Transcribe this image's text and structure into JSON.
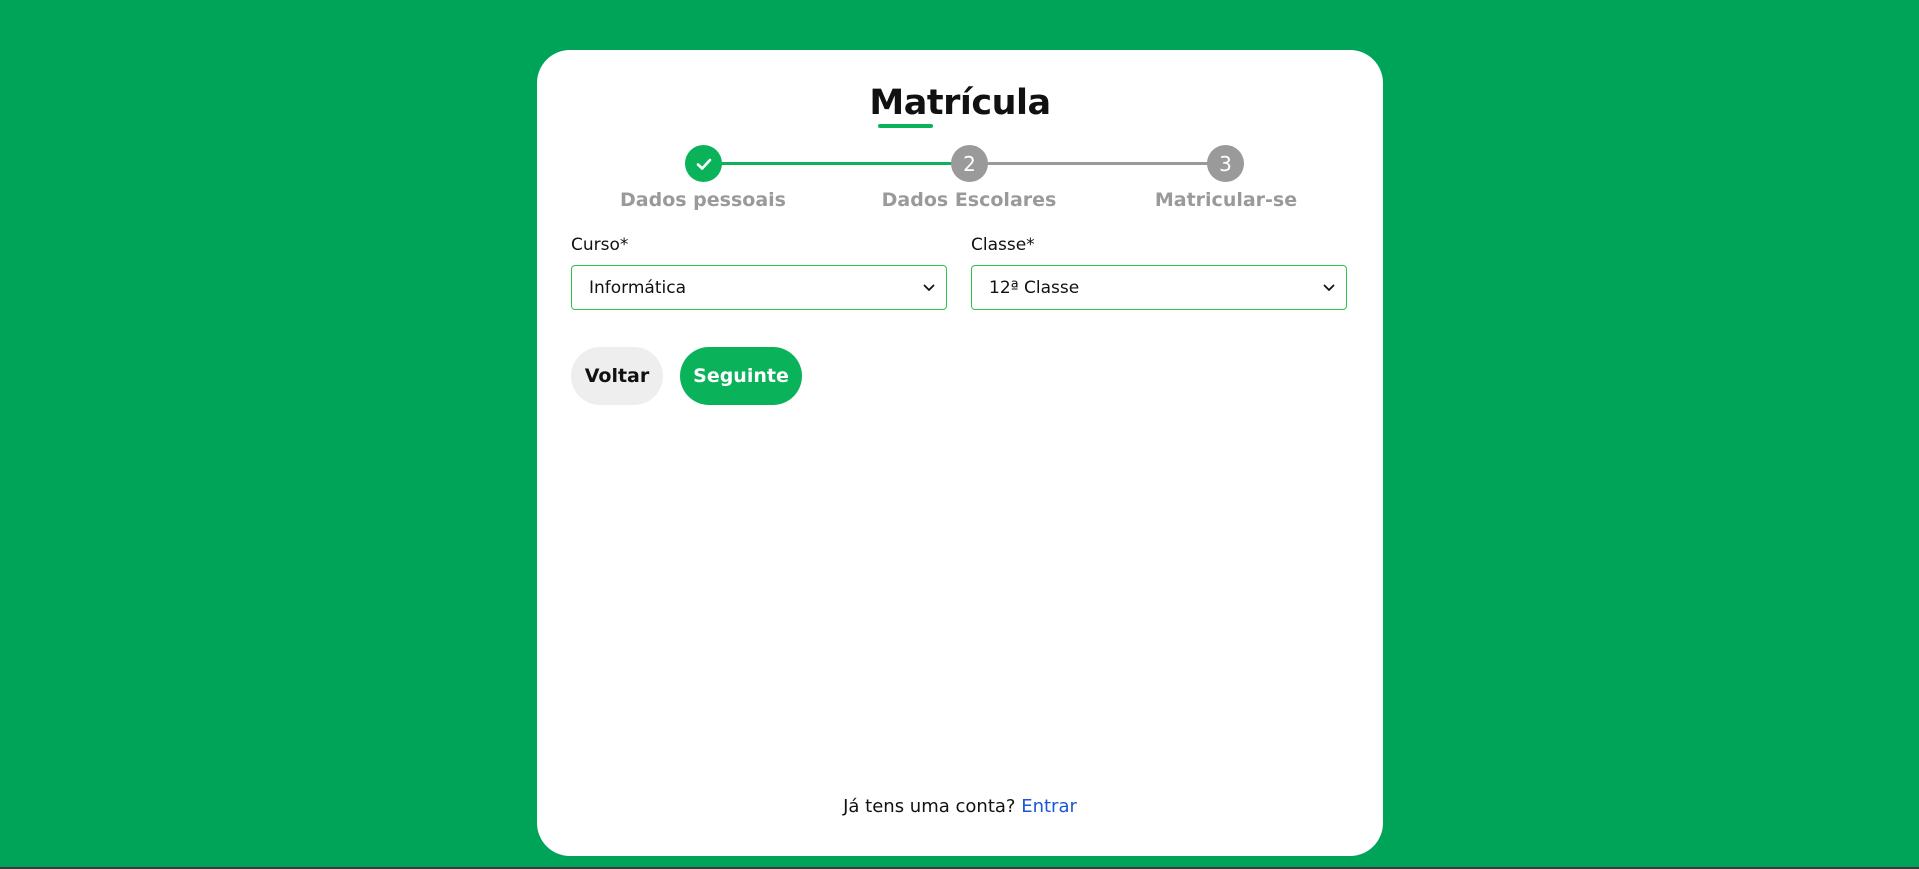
{
  "page": {
    "background_color": "#00a459",
    "accent_color": "#0ab35a",
    "link_color": "#1a56d6"
  },
  "form": {
    "title": "Matrícula",
    "steps": [
      {
        "label": "Dados pessoais",
        "number": "1",
        "status": "done",
        "icon": "check-icon"
      },
      {
        "label": "Dados Escolares",
        "number": "2",
        "status": "current"
      },
      {
        "label": "Matricular-se",
        "number": "3",
        "status": "pending"
      }
    ],
    "fields": {
      "curso": {
        "label": "Curso*",
        "value": "Informática"
      },
      "classe": {
        "label": "Classe*",
        "value": "12ª Classe"
      }
    },
    "buttons": {
      "back_label": "Voltar",
      "next_label": "Seguinte"
    },
    "footer": {
      "prompt": "Já tens uma conta?",
      "link_label": "Entrar"
    }
  }
}
